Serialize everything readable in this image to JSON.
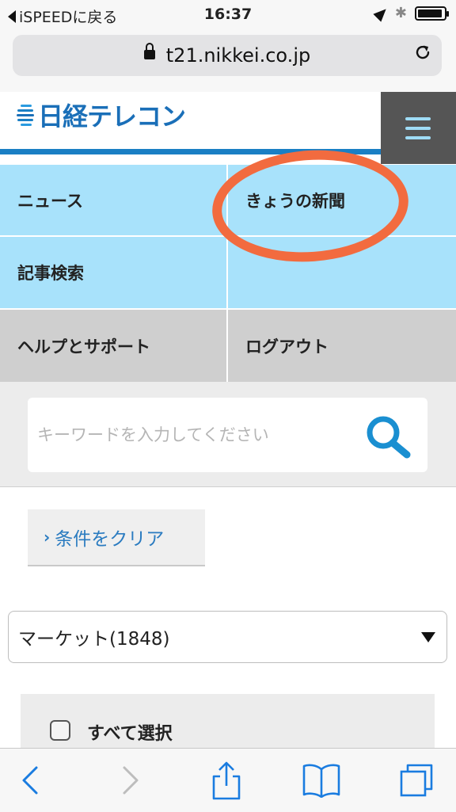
{
  "status_bar": {
    "back_label": "iSPEEDに戻る",
    "time": "16:37"
  },
  "browser": {
    "url": "t21.nikkei.co.jp"
  },
  "site": {
    "logo_text": "日経テレコン"
  },
  "nav": {
    "news": "ニュース",
    "todays_paper": "きょうの新聞",
    "article_search": "記事検索",
    "help_support": "ヘルプとサポート",
    "logout": "ログアウト"
  },
  "search": {
    "placeholder": "キーワードを入力してください"
  },
  "filters": {
    "clear_label": "条件をクリア",
    "select_value": "マーケット(1848)",
    "select_all_label": "すべて選択"
  },
  "colors": {
    "accent": "#1a7fc4",
    "nav_blue": "#a8e2fb",
    "nav_gray": "#cfcfcf",
    "annotation": "#f26b3f",
    "link": "#2a7bc0"
  }
}
